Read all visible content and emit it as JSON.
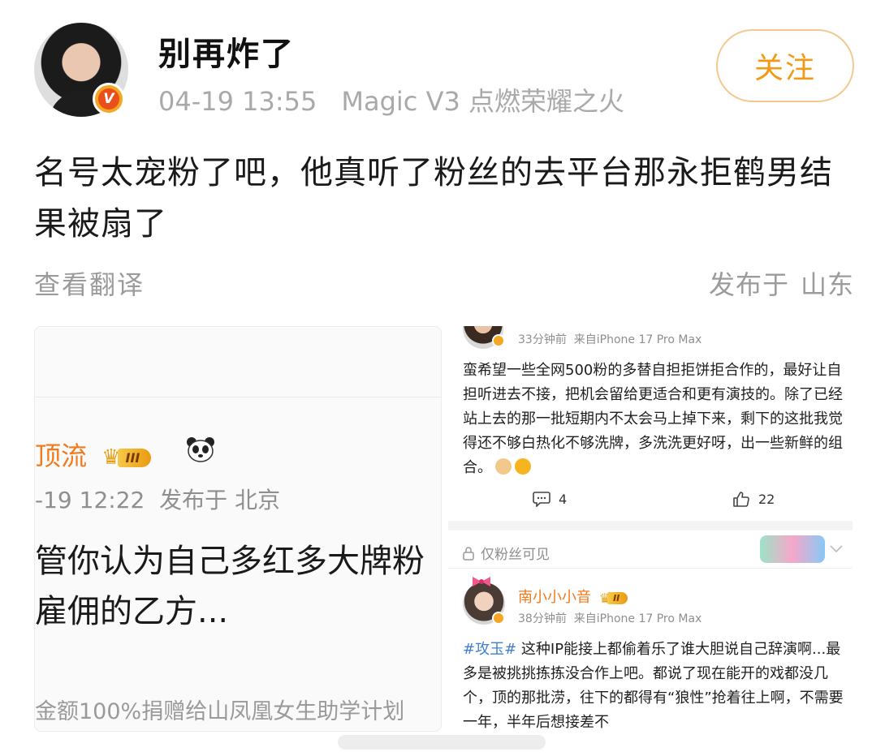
{
  "post": {
    "username": "别再炸了",
    "timestamp": "04-19 13:55",
    "device": "Magic V3 点燃荣耀之火",
    "follow_label": "关注",
    "text": "名号太宠粉了吧，他真听了粉丝的去平台那永拒鹤男结果被扇了",
    "translate_label": "查看翻译",
    "location_prefix": "发布于",
    "location": "山东",
    "verified_badge": "V"
  },
  "left_image": {
    "name": "顶流",
    "vip_level": "III",
    "date": "-19 12:22",
    "location_prefix": "发布于",
    "location": "北京",
    "text_lines": [
      "管你认为自己多红多大牌粉",
      "雇佣的乙方..."
    ],
    "footer": "金额100%捐赠给山凤凰女生助学计划"
  },
  "right_image": {
    "comment1": {
      "time": "33分钟前",
      "source": "来自iPhone 17 Pro Max",
      "text": "蛮希望一些全网500粉的多替自担拒饼拒合作的，最好让自担听进去不接，把机会留给更适合和更有演技的。除了已经站上去的那一批短期内不太会马上掉下来，剩下的这批我觉得还不够白热化不够洗牌，多洗洗更好呀，出一些新鲜的组合。",
      "comment_count": "4",
      "like_count": "22"
    },
    "comment2": {
      "visibility": "仅粉丝可见",
      "name": "南小小小音",
      "vip_level": "II",
      "time": "38分钟前",
      "source": "来自iPhone 17 Pro Max",
      "topic": "#攻玉#",
      "text": " 这种IP能接上都偷着乐了谁大胆说自己辞演啊...最多是被挑挑拣拣没合作上吧。都说了现在能开的戏都没几个，顶的那批涝，往下的都得有“狼性”抢着往上啊，不需要一年，半年后想接差不"
    }
  },
  "colors": {
    "accent_orange": "#f29a17",
    "name_orange": "#f07a1c",
    "topic_blue": "#3f7fd1",
    "muted_gray": "#9b9b9b"
  }
}
